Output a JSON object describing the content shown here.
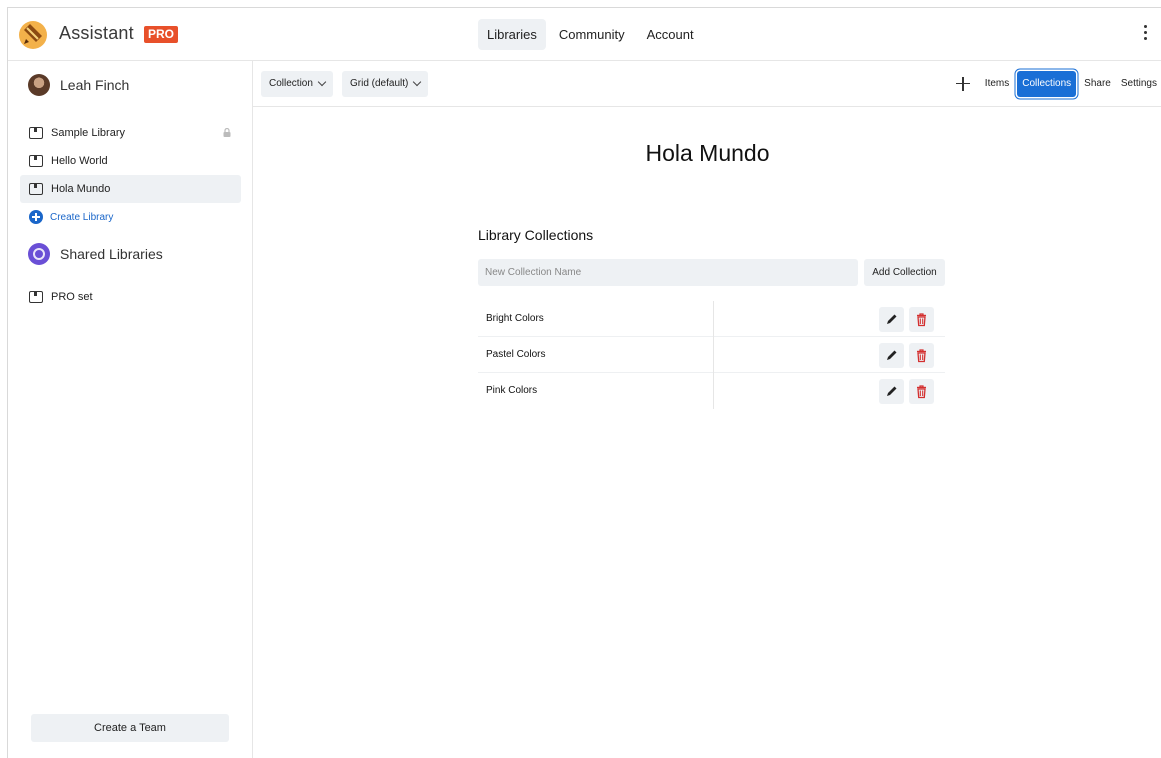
{
  "header": {
    "app_name": "Assistant",
    "badge": "PRO",
    "nav": [
      "Libraries",
      "Community",
      "Account"
    ],
    "active_nav": "Libraries"
  },
  "sidebar": {
    "user_name": "Leah Finch",
    "libraries": [
      {
        "label": "Sample Library",
        "locked": true
      },
      {
        "label": "Hello World",
        "locked": false
      },
      {
        "label": "Hola Mundo",
        "locked": false,
        "active": true
      }
    ],
    "create_library": "Create Library",
    "shared_title": "Shared Libraries",
    "shared": [
      {
        "label": "PRO set"
      }
    ],
    "create_team": "Create a Team"
  },
  "toolbar": {
    "view_select": "Collection",
    "layout_select": "Grid (default)",
    "tabs": [
      "Items",
      "Collections",
      "Share",
      "Settings"
    ],
    "active_tab": "Collections"
  },
  "main": {
    "title": "Hola Mundo",
    "section_title": "Library Collections",
    "input_placeholder": "New Collection Name",
    "add_button": "Add Collection",
    "collections": [
      "Bright Colors",
      "Pastel Colors",
      "Pink Colors"
    ]
  },
  "colors": {
    "accent": "#1a6fd6",
    "badge": "#e8502a",
    "delete": "#d32f2f",
    "muted_bg": "#eef1f4"
  }
}
